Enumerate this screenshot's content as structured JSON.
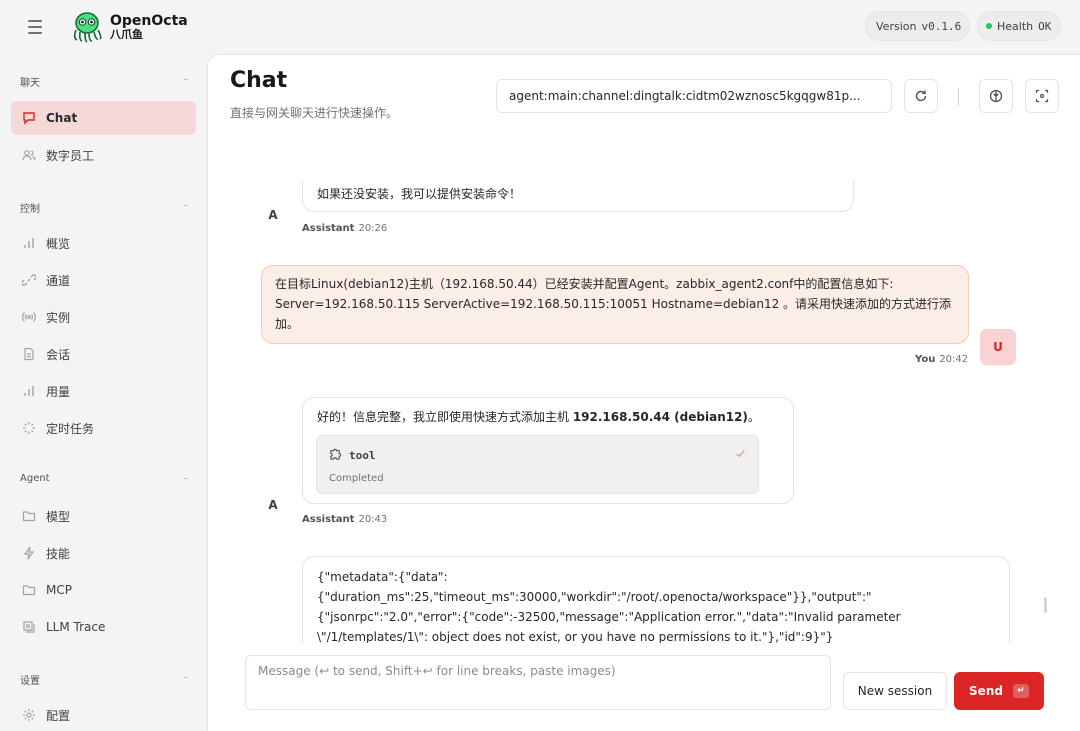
{
  "app": {
    "name": "OpenOcta",
    "subname": "八爪鱼",
    "version_label": "Version",
    "version_value": "v0.1.6",
    "health_label": "Health",
    "health_value": "OK"
  },
  "sidebar": {
    "groups": [
      {
        "title": "聊天",
        "items": [
          {
            "label": "Chat",
            "icon": "chat-bubble-icon",
            "active": true
          },
          {
            "label": "数字员工",
            "icon": "users-icon"
          }
        ]
      },
      {
        "title": "控制",
        "items": [
          {
            "label": "概览",
            "icon": "bar-chart-icon"
          },
          {
            "label": "通道",
            "icon": "link-icon"
          },
          {
            "label": "实例",
            "icon": "broadcast-icon"
          },
          {
            "label": "会话",
            "icon": "document-icon"
          },
          {
            "label": "用量",
            "icon": "bar-chart-icon"
          },
          {
            "label": "定时任务",
            "icon": "loader-icon"
          }
        ]
      },
      {
        "title": "Agent",
        "items": [
          {
            "label": "模型",
            "icon": "folder-icon"
          },
          {
            "label": "技能",
            "icon": "bolt-icon"
          },
          {
            "label": "MCP",
            "icon": "folder-icon"
          },
          {
            "label": "LLM Trace",
            "icon": "trace-icon"
          }
        ]
      },
      {
        "title": "设置",
        "items": [
          {
            "label": "配置",
            "icon": "gear-icon"
          }
        ]
      }
    ],
    "collapse_glyph": "–"
  },
  "header": {
    "title": "Chat",
    "subtitle": "直接与网关聊天进行快速操作。",
    "session_key": "agent:main:channel:dingtalk:cidtm02wznosc5kgqgw81p..."
  },
  "messages": [
    {
      "role": "assistant",
      "avatar": "A",
      "text": "如果还没安装，我可以提供安装命令！",
      "sender": "Assistant",
      "time": "20:26"
    },
    {
      "role": "user",
      "avatar": "U",
      "lines": [
        "在目标Linux(debian12)主机（192.168.50.44）已经安装并配置Agent。zabbix_agent2.conf中的配置信息如下:",
        "Server=192.168.50.115 ServerActive=192.168.50.115:10051 Hostname=debian12 。请采用快速添加的方式进行添",
        "加。"
      ],
      "sender": "You",
      "time": "20:42"
    },
    {
      "role": "assistant",
      "avatar": "A",
      "text_prefix": "好的！信息完整，我立即使用快速方式添加主机 ",
      "text_bold": "192.168.50.44 (debian12)",
      "text_suffix": "。",
      "tool": {
        "name": "tool",
        "status": "Completed"
      },
      "sender": "Assistant",
      "time": "20:43"
    },
    {
      "role": "assistant",
      "lines": [
        "{\"metadata\":{\"data\":",
        "{\"duration_ms\":25,\"timeout_ms\":30000,\"workdir\":\"/root/.openocta/workspace\"}},\"output\":\"",
        "{\"jsonrpc\":\"2.0\",\"error\":{\"code\":-32500,\"message\":\"Application error.\",\"data\":\"Invalid parameter",
        "\\\"/1/templates/1\\\": object does not exist, or you have no permissions to it.\"},\"id\":9}\"}"
      ]
    }
  ],
  "composer": {
    "placeholder": "Message (↩ to send, Shift+↩ for line breaks, paste images)",
    "new_session_label": "New session",
    "send_label": "Send",
    "send_shortcut": "↵"
  },
  "colors": {
    "accent": "#dc2626",
    "active_bg": "#f5d9d9",
    "user_bubble": "#fbeee6",
    "health_dot": "#22c55e"
  }
}
